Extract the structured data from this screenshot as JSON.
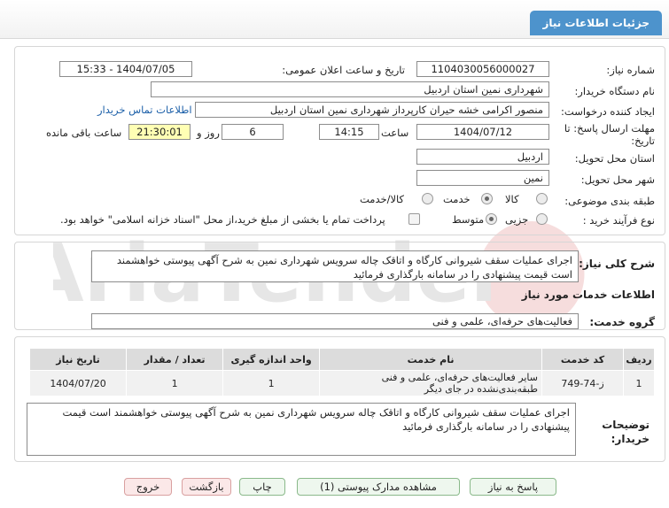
{
  "header": {
    "title": "جزئیات اطلاعات نیاز"
  },
  "form": {
    "need_number_label": "شماره نیاز:",
    "need_number": "1104030056000027",
    "announce_label": "تاریخ و ساعت اعلان عمومی:",
    "announce_value": "1404/07/05 - 15:33",
    "buyer_org_label": "نام دستگاه خریدار:",
    "buyer_org": "شهرداری نمین استان اردبیل",
    "creator_label": "ایجاد کننده درخواست:",
    "creator": "منصور اکرامی خشه حیران کارپرداز شهرداری نمین استان اردبیل",
    "contact_link": "اطلاعات تماس خریدار",
    "deadline_label_1": "مهلت ارسال پاسخ: تا",
    "deadline_label_2": "تاریخ:",
    "deadline_date": "1404/07/12",
    "time_label": "ساعت",
    "deadline_time": "14:15",
    "days_value": "6",
    "days_label": "روز و",
    "remaining_time": "21:30:01",
    "remaining_label": "ساعت باقی مانده",
    "province_label": "استان محل تحویل:",
    "province": "اردبیل",
    "city_label": "شهر محل تحویل:",
    "city": "نمین",
    "category_label": "طبقه بندی موضوعی:",
    "category_options": [
      "کالا",
      "خدمت",
      "کالا/خدمت"
    ],
    "category_selected": "خدمت",
    "process_label": "نوع فرآیند خرید :",
    "process_options": [
      "جزیی",
      "متوسط"
    ],
    "process_selected": "متوسط",
    "payment_note": "پرداخت تمام یا بخشی از مبلغ خرید،از محل \"اسناد خزانه اسلامی\" خواهد بود."
  },
  "summary": {
    "label": "شرح کلی نیاز:",
    "text": "اجرای عملیات سقف شیروانی کارگاه و اتاقک چاله سرویس شهرداری نمین به شرح آگهی پیوستی خواهشمند است قیمت پیشنهادی را در سامانه بارگذاری فرمائید"
  },
  "services": {
    "section_title": "اطلاعات خدمات مورد نیاز",
    "group_label": "گروه خدمت:",
    "group_value": "فعالیت‌های حرفه‌ای، علمی و فنی",
    "columns": [
      "ردیف",
      "کد خدمت",
      "نام خدمت",
      "واحد اندازه گیری",
      "تعداد / مقدار",
      "تاریخ نیاز"
    ],
    "rows": [
      [
        "1",
        "ز-74-749",
        "سایر فعالیت‌های حرفه‌ای، علمی و فنی طبقه‌بندی‌نشده در جای دیگر",
        "1",
        "1",
        "1404/07/20"
      ]
    ]
  },
  "buyer_notes": {
    "label_1": "توضیحات",
    "label_2": "خریدار:",
    "text": "اجرای عملیات سقف شیروانی کارگاه و اتاقک چاله سرویس شهرداری نمین به شرح آگهی پیوستی خواهشمند است قیمت پیشنهادی را در سامانه بارگذاری فرمائید"
  },
  "buttons": {
    "respond": "پاسخ به نیاز",
    "attachments": "مشاهده مدارک پیوستی (1)",
    "print": "چاپ",
    "back": "بازگشت",
    "exit": "خروج"
  },
  "colors": {
    "title_tab": "#4d93cc",
    "remaining_bg": "#ffffb4",
    "link": "#1b5fa8"
  }
}
